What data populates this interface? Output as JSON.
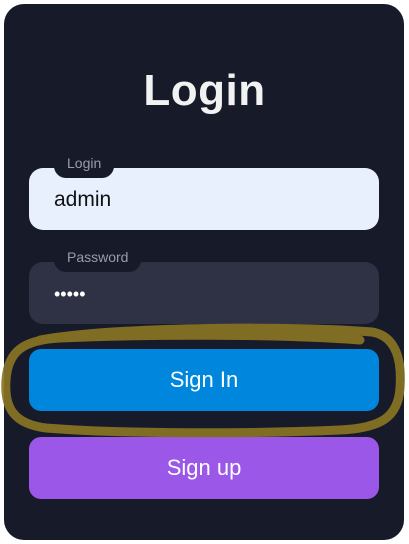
{
  "form": {
    "title": "Login",
    "login_label": "Login",
    "login_value": "admin",
    "password_label": "Password",
    "password_value": "•••••",
    "signin_label": "Sign In",
    "signup_label": "Sign up"
  },
  "colors": {
    "card": "#171a29",
    "login_field": "#e8f0fe",
    "password_field": "#2f3245",
    "signin_button": "#0086dc",
    "signup_button": "#9a57e8",
    "highlight": "#8a7424"
  }
}
